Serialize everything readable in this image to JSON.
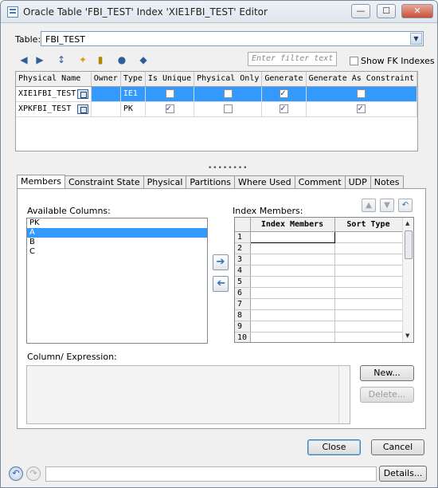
{
  "window": {
    "title": "Oracle Table 'FBI_TEST' Index 'XIE1FBI_TEST' Editor",
    "min_label": "—",
    "max_label": "☐",
    "close_label": "✕"
  },
  "table_selector": {
    "label": "Table:",
    "value": "FBI_TEST"
  },
  "toolbar": {
    "filter_placeholder": "Enter filter text",
    "show_fk_label": "Show FK Indexes",
    "show_fk_checked": false
  },
  "index_grid": {
    "columns": [
      "Physical Name",
      "Owner",
      "Type",
      "Is Unique",
      "Physical Only",
      "Generate",
      "Generate As Constraint"
    ],
    "rows": [
      {
        "name": "XIE1FBI_TEST",
        "owner": "",
        "type": "IE1",
        "is_unique": false,
        "physical_only": false,
        "generate": true,
        "as_constraint": false,
        "selected": true
      },
      {
        "name": "XPKFBI_TEST",
        "owner": "",
        "type": "PK",
        "is_unique": true,
        "physical_only": false,
        "generate": true,
        "as_constraint": true,
        "selected": false
      }
    ]
  },
  "splitter_grip": "••••••••",
  "tabs": [
    "Members",
    "Constraint State",
    "Physical",
    "Partitions",
    "Where Used",
    "Comment",
    "UDP",
    "Notes"
  ],
  "active_tab": "Members",
  "members": {
    "available_label": "Available Columns:",
    "available_columns": [
      "PK",
      "A",
      "B",
      "C"
    ],
    "selected_available": "A",
    "index_members_label": "Index Members:",
    "member_columns": [
      "Index Members",
      "Sort Type"
    ],
    "row_numbers": [
      "1",
      "2",
      "3",
      "4",
      "5",
      "6",
      "7",
      "8",
      "9",
      "10"
    ],
    "column_expression_label": "Column/ Expression:",
    "new_label": "New...",
    "delete_label": "Delete..."
  },
  "buttons": {
    "close": "Close",
    "cancel": "Cancel",
    "details": "Details..."
  },
  "colors": {
    "selection": "#3399ff",
    "tab_border": "#9a9a9a"
  }
}
